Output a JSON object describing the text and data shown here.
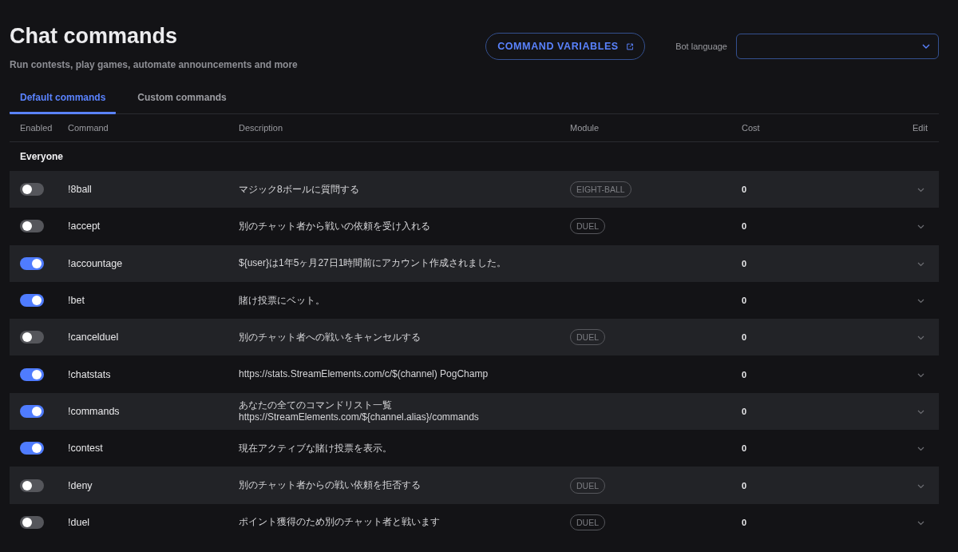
{
  "header": {
    "title": "Chat commands",
    "subtitle": "Run contests, play games, automate announcements and more"
  },
  "command_variables_button": {
    "label": "COMMAND VARIABLES"
  },
  "bot_language": {
    "label": "Bot language"
  },
  "tabs": [
    {
      "label": "Default commands",
      "selected": true
    },
    {
      "label": "Custom commands",
      "selected": false
    }
  ],
  "table": {
    "columns": [
      "Enabled",
      "Command",
      "Description",
      "Module",
      "Cost",
      "Edit"
    ],
    "groups": [
      {
        "name": "Everyone",
        "rows": [
          {
            "enabled": false,
            "command": "!8ball",
            "description": [
              "マジック8ボールに質問する"
            ],
            "module": "EIGHT-BALL",
            "cost": "0"
          },
          {
            "enabled": false,
            "command": "!accept",
            "description": [
              "別のチャット者から戦いの依頼を受け入れる"
            ],
            "module": "DUEL",
            "cost": "0"
          },
          {
            "enabled": true,
            "command": "!accountage",
            "description": [
              "${user}は1年5ヶ月27日1時間前にアカウント作成されました。"
            ],
            "cost": "0"
          },
          {
            "enabled": true,
            "command": "!bet",
            "description": [
              "賭け投票にベット。"
            ],
            "cost": "0"
          },
          {
            "enabled": false,
            "command": "!cancelduel",
            "description": [
              "別のチャット者への戦いをキャンセルする"
            ],
            "module": "DUEL",
            "cost": "0"
          },
          {
            "enabled": true,
            "command": "!chatstats",
            "description": [
              "https://stats.StreamElements.com/c/$(channel) PogChamp"
            ],
            "cost": "0"
          },
          {
            "enabled": true,
            "command": "!commands",
            "description": [
              "あなたの全てのコマンドリスト一覧",
              "https://StreamElements.com/${channel.alias}/commands"
            ],
            "cost": "0"
          },
          {
            "enabled": true,
            "command": "!contest",
            "description": [
              "現在アクティブな賭け投票を表示。"
            ],
            "cost": "0"
          },
          {
            "enabled": false,
            "command": "!deny",
            "description": [
              "別のチャット者からの戦い依頼を拒否する"
            ],
            "module": "DUEL",
            "cost": "0"
          },
          {
            "enabled": false,
            "command": "!duel",
            "description": [
              "ポイント獲得のため別のチャット者と戦います"
            ],
            "module": "DUEL",
            "cost": "0"
          }
        ]
      }
    ]
  }
}
